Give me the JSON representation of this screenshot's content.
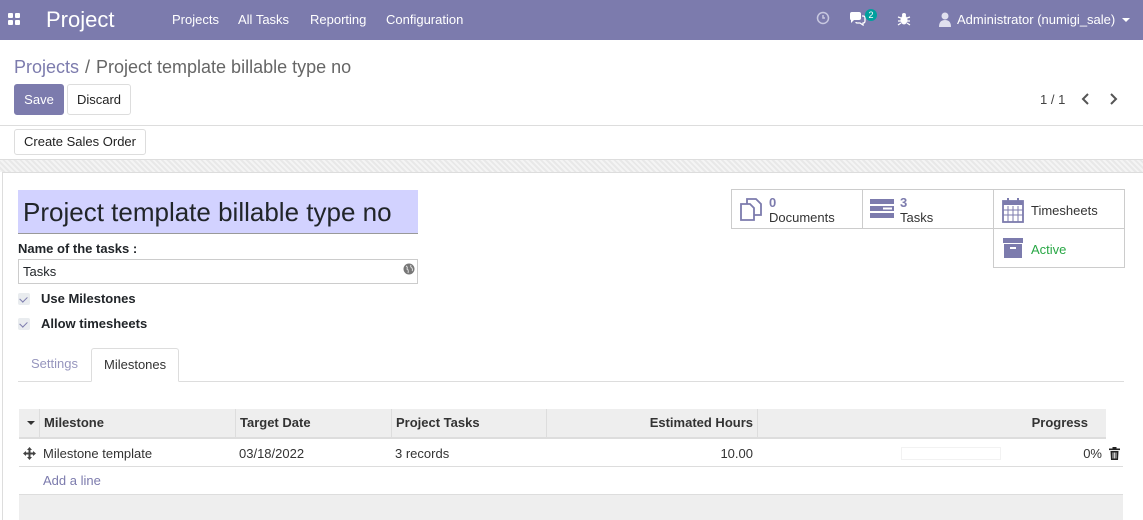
{
  "navbar": {
    "app_name": "Project",
    "menu": [
      "Projects",
      "All Tasks",
      "Reporting",
      "Configuration"
    ],
    "messages_count": "2",
    "user": "Administrator (numigi_sale)",
    "icons": [
      "apps-grid-icon",
      "clock-icon",
      "chat-icon",
      "bug-icon",
      "user-avatar-icon"
    ]
  },
  "breadcrumb": {
    "parent": "Projects",
    "separator": "/",
    "current": "Project template billable type no"
  },
  "actions": {
    "save": "Save",
    "discard": "Discard"
  },
  "pager": {
    "value": "1 / 1"
  },
  "statusbar": {
    "create_sales_order": "Create Sales Order"
  },
  "form": {
    "name": "Project template billable type no",
    "tasks_label": "Name of the tasks :",
    "tasks_value": "Tasks",
    "use_milestones": {
      "label": "Use Milestones",
      "checked": true
    },
    "allow_timesheets": {
      "label": "Allow timesheets",
      "checked": true
    }
  },
  "smart_buttons": {
    "documents": {
      "count": "0",
      "label": "Documents"
    },
    "tasks": {
      "count": "3",
      "label": "Tasks"
    },
    "timesheets": {
      "label": "Timesheets"
    },
    "active": {
      "label": "Active"
    }
  },
  "tabs": [
    "Settings",
    "Milestones"
  ],
  "active_tab": "Milestones",
  "milestones": {
    "columns": [
      "Milestone",
      "Target Date",
      "Project Tasks",
      "Estimated Hours",
      "Progress"
    ],
    "rows": [
      {
        "milestone": "Milestone template",
        "target_date": "03/18/2022",
        "project_tasks": "3 records",
        "estimated_hours": "10.00",
        "progress_text": "0%",
        "progress_value": 0
      }
    ],
    "add_line": "Add a line"
  },
  "colors": {
    "primary": "#7c7bad",
    "active_green": "#28a745",
    "title_bg": "#d2d2ff"
  }
}
